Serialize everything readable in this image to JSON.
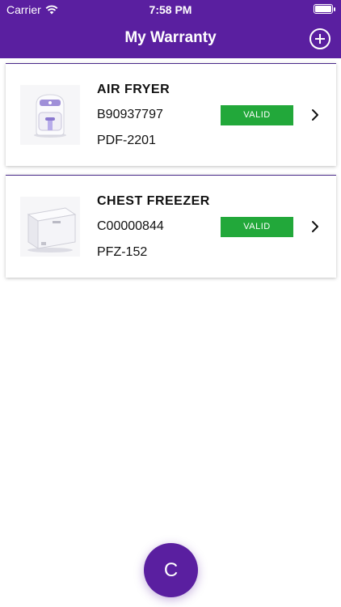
{
  "status_bar": {
    "carrier": "Carrier",
    "time": "7:58 PM"
  },
  "header": {
    "title": "My Warranty",
    "add_icon": "plus-circle-icon"
  },
  "warranties": [
    {
      "name": "AIR FRYER",
      "serial": "B90937797",
      "model": "PDF-2201",
      "status": "VALID",
      "image": "air-fryer-image"
    },
    {
      "name": "CHEST FREEZER",
      "serial": "C00000844",
      "model": "PFZ-152",
      "status": "VALID",
      "image": "chest-freezer-image"
    }
  ],
  "fab": {
    "label": "C"
  },
  "colors": {
    "brand": "#5a1fa0",
    "valid": "#22a83a"
  }
}
